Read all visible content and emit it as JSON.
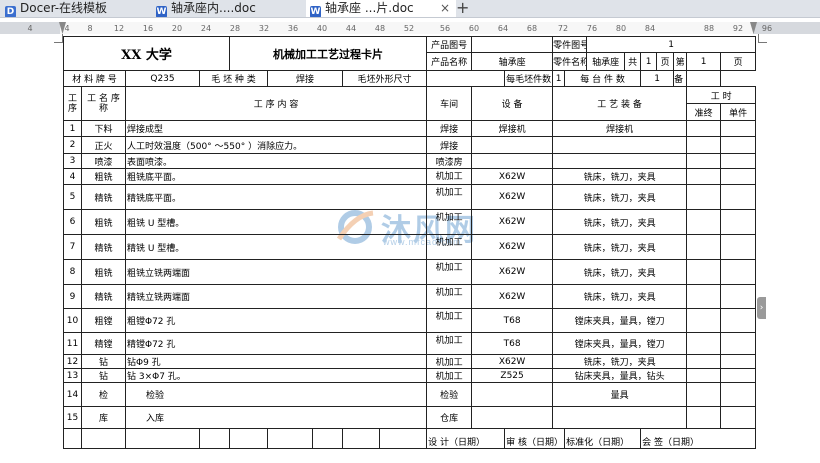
{
  "tabs": [
    {
      "label": "Docer-在线模板",
      "icon": "docer-icon"
    },
    {
      "label": "轴承座内....doc",
      "icon": "doc-icon"
    },
    {
      "label": "轴承座   ...片.doc",
      "icon": "doc-icon"
    }
  ],
  "new_tab": "+",
  "close_glyph": "×",
  "ruler": [
    "4",
    "4",
    "8",
    "12",
    "16",
    "20",
    "24",
    "28",
    "32",
    "36",
    "40",
    "44",
    "48",
    "52",
    "56",
    "60",
    "64",
    "68",
    "72",
    "76",
    "80",
    "84",
    "88",
    "92",
    "96"
  ],
  "watermark": {
    "brand": "沐风网",
    "url": "www.mfcad.com"
  },
  "card": {
    "school": "XX 大学",
    "title": "机械加工工艺过程卡片",
    "product_code_label": "产品图号",
    "product_code": "",
    "part_code_label": "零件图号",
    "part_code": "1",
    "product_name_label": "产品名称",
    "product_name": "轴承座",
    "part_name_label": "零件名称",
    "part_name": "轴承座",
    "total_label": "共",
    "total_pages": "1",
    "page_unit": "页",
    "page_label": "第",
    "page_no": "1",
    "material_label": "材 料 牌 号",
    "material": "Q235",
    "blank_type_label": "毛 坯 种 类",
    "blank_type": "焊接",
    "blank_size_label": "毛坯外形尺寸",
    "blank_size": "",
    "per_blank_label": "每毛坯件数",
    "per_blank": "1",
    "per_unit_label": "每 台 件 数",
    "per_unit": "1",
    "remark_label": "备 注"
  },
  "headers": {
    "seq": "工 序",
    "name": "工 名 序 称",
    "content": "工      序      内      容",
    "workshop": "车间",
    "equipment": "设  备",
    "tooling": "工   艺   装   备",
    "time": "工      时",
    "prep": "准终",
    "unit": "单件"
  },
  "rows": [
    {
      "no": "1",
      "name": "下料",
      "content": "焊接成型",
      "shop": "焊接",
      "equip": "焊接机",
      "tool": "焊接机"
    },
    {
      "no": "2",
      "name": "正火",
      "content": "人工时效温度（500° ～550° ）消除应力。",
      "shop": "焊接",
      "equip": "",
      "tool": ""
    },
    {
      "no": "3",
      "name": "喷漆",
      "content": "表面喷漆。",
      "shop": "喷漆房",
      "equip": "",
      "tool": ""
    },
    {
      "no": "4",
      "name": "粗铣",
      "content": "粗铣底平面。",
      "shop": "机加工",
      "equip": "X62W",
      "tool": "铣床，铣刀，夹具"
    },
    {
      "no": "5",
      "name": "精铣",
      "content": "精铣底平面。",
      "shop": "机加工",
      "equip": "X62W",
      "tool": "铣床，铣刀，夹具"
    },
    {
      "no": "6",
      "name": "粗铣",
      "content": "粗铣 U 型槽。",
      "shop": "机加工",
      "equip": "X62W",
      "tool": "铣床，铣刀，夹具"
    },
    {
      "no": "7",
      "name": "精铣",
      "content": "精铣 U 型槽。",
      "shop": "机加工",
      "equip": "X62W",
      "tool": "铣床，铣刀，夹具"
    },
    {
      "no": "8",
      "name": "粗铣",
      "content": "粗铣立铣两端面",
      "shop": "机加工",
      "equip": "X62W",
      "tool": "铣床，铣刀，夹具"
    },
    {
      "no": "9",
      "name": "精铣",
      "content": "精铣立铣两端面",
      "shop": "机加工",
      "equip": "X62W",
      "tool": "铣床，铣刀，夹具"
    },
    {
      "no": "10",
      "name": "粗镗",
      "content": "粗镗Φ72 孔",
      "shop": "机加工",
      "equip": "T68",
      "tool": "镗床夹具，量具，镗刀"
    },
    {
      "no": "11",
      "name": "精镗",
      "content": "精镗Φ72 孔",
      "shop": "机加工",
      "equip": "T68",
      "tool": "镗床夹具，量具，镗刀"
    },
    {
      "no": "12",
      "name": "钻",
      "content": "钻Φ9 孔",
      "shop": "机加工",
      "equip": "X62W",
      "tool": "铣床，铣刀，夹具"
    },
    {
      "no": "13",
      "name": "钻",
      "content": "钻 3×Φ7 孔。",
      "shop": "机加工",
      "equip": "Z525",
      "tool": "钻床夹具，量具，钻头"
    },
    {
      "no": "14",
      "name": "检",
      "content": "检验",
      "shop": "检验",
      "equip": "",
      "tool": "量具"
    },
    {
      "no": "15",
      "name": "库",
      "content": "入库",
      "shop": "仓库",
      "equip": "",
      "tool": ""
    }
  ],
  "footer": [
    "设 计（日期）",
    "审 核（日期）",
    "标准化（日期）",
    "会 签（日期）"
  ]
}
